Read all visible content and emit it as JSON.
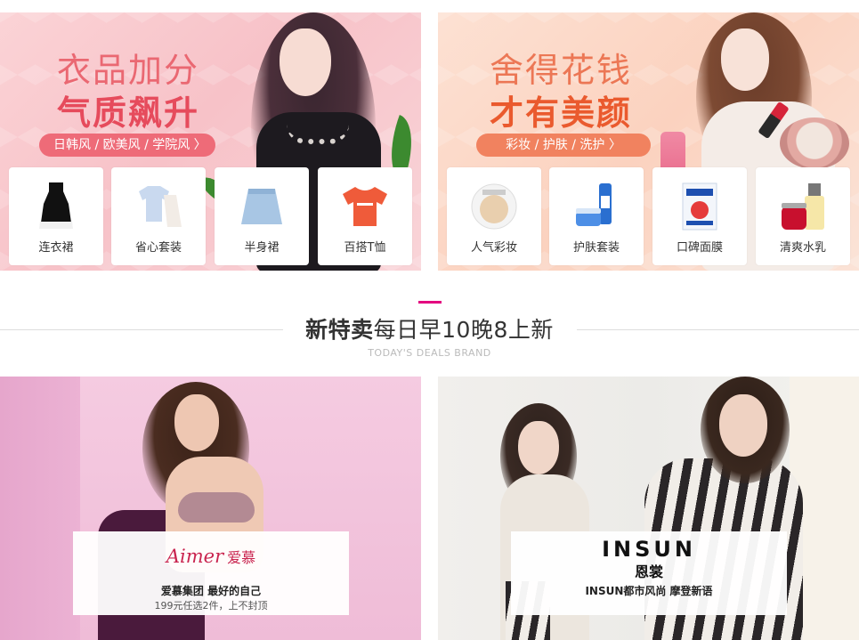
{
  "banners": {
    "fashion": {
      "headline1": "衣品加分",
      "headline2": "气质飙升",
      "pill": "日韩风 / 欧美风 / 学院风 〉",
      "cards": [
        {
          "label": "连衣裙",
          "icon": "dress-icon"
        },
        {
          "label": "省心套装",
          "icon": "outfit-set-icon"
        },
        {
          "label": "半身裙",
          "icon": "skirt-icon"
        },
        {
          "label": "百搭T恤",
          "icon": "tshirt-icon"
        }
      ]
    },
    "beauty": {
      "headline1": "舍得花钱",
      "headline2": "才有美颜",
      "pill": "彩妆 / 护肤 / 洗护 〉",
      "cards": [
        {
          "label": "人气彩妆",
          "icon": "cushion-compact-icon"
        },
        {
          "label": "护肤套装",
          "icon": "skincare-set-icon"
        },
        {
          "label": "口碑面膜",
          "icon": "face-mask-icon"
        },
        {
          "label": "清爽水乳",
          "icon": "lotion-bottle-icon"
        }
      ]
    }
  },
  "section": {
    "title_bold": "新特卖",
    "title_rest": "每日早10晚8上新",
    "subtitle": "TODAY'S DEALS BRAND",
    "accent_color": "#e4007f"
  },
  "brands": {
    "aimer": {
      "logo_latin": "Aimer",
      "logo_cn": "爱慕",
      "slogan": "爱慕集团 最好的自己",
      "sub": "199元任选2件，上不封顶"
    },
    "insun": {
      "logo_latin": "INSUN",
      "logo_cn": "恩裳",
      "slogan": "INSUN都市风尚 摩登新语"
    }
  }
}
